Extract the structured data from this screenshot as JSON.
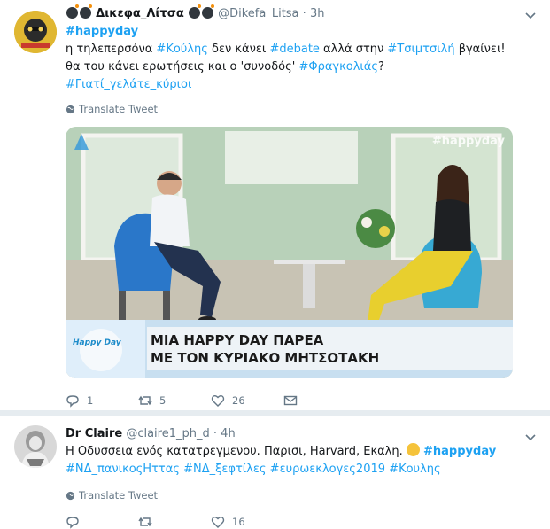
{
  "tweets": [
    {
      "name": "Δικεφα_Λίτσα",
      "handle": "@Dikefa_Litsa",
      "separator": "·",
      "time": "3h",
      "lines": [
        [
          {
            "t": "#happyday",
            "tag": true,
            "bold": true
          }
        ],
        [
          {
            "t": "η τηλεπερσόνα "
          },
          {
            "t": "#Κούλης",
            "tag": true
          },
          {
            "t": " δεν κάνει "
          },
          {
            "t": "#debate",
            "tag": true
          },
          {
            "t": " αλλά στην "
          },
          {
            "t": "#Τσιμτσιλή",
            "tag": true
          },
          {
            "t": " βγαίνει!"
          }
        ],
        [
          {
            "t": "θα του κάνει ερωτήσεις και ο 'συνοδός' "
          },
          {
            "t": "#Φραγκολιάς",
            "tag": true
          },
          {
            "t": "?"
          }
        ],
        [
          {
            "t": "#Γιατί_γελάτε_κύριοι",
            "tag": true
          }
        ]
      ],
      "translate": "Translate Tweet",
      "media": {
        "watermark": "#happyday",
        "banner_line1": "ΜΙΑ HAPPY DAY ΠΑΡΕΑ",
        "banner_line2": "ΜΕ ΤΟΝ ΚΥΡΙΑΚΟ ΜΗΤΣΟΤΑΚΗ",
        "show_logo": "Happy Day"
      },
      "actions": {
        "reply": "1",
        "retweet": "5",
        "like": "26"
      }
    },
    {
      "name": "Dr Claire",
      "handle": "@claire1_ph_d",
      "separator": "·",
      "time": "4h",
      "lines": [
        [
          {
            "t": "Η Οδυσσεια ενός κατατρεγμενου. Παρισι, Harvard, Εκαλη. "
          },
          {
            "t": "#happyday",
            "tag": true,
            "bold": true
          }
        ],
        [
          {
            "t": "#ΝΔ_πανικοςΗττας",
            "tag": true
          },
          {
            "t": " "
          },
          {
            "t": "#ΝΔ_ξεφτίλες",
            "tag": true
          },
          {
            "t": " "
          },
          {
            "t": "#ευρωεκλογες2019",
            "tag": true
          },
          {
            "t": " "
          },
          {
            "t": "#Κουλης",
            "tag": true
          }
        ]
      ],
      "translate": "Translate Tweet",
      "actions": {
        "reply": "",
        "retweet": "",
        "like": "16"
      }
    }
  ],
  "colors": {
    "link": "#1da1f2",
    "muted": "#657786",
    "border": "#e6ecf0"
  }
}
